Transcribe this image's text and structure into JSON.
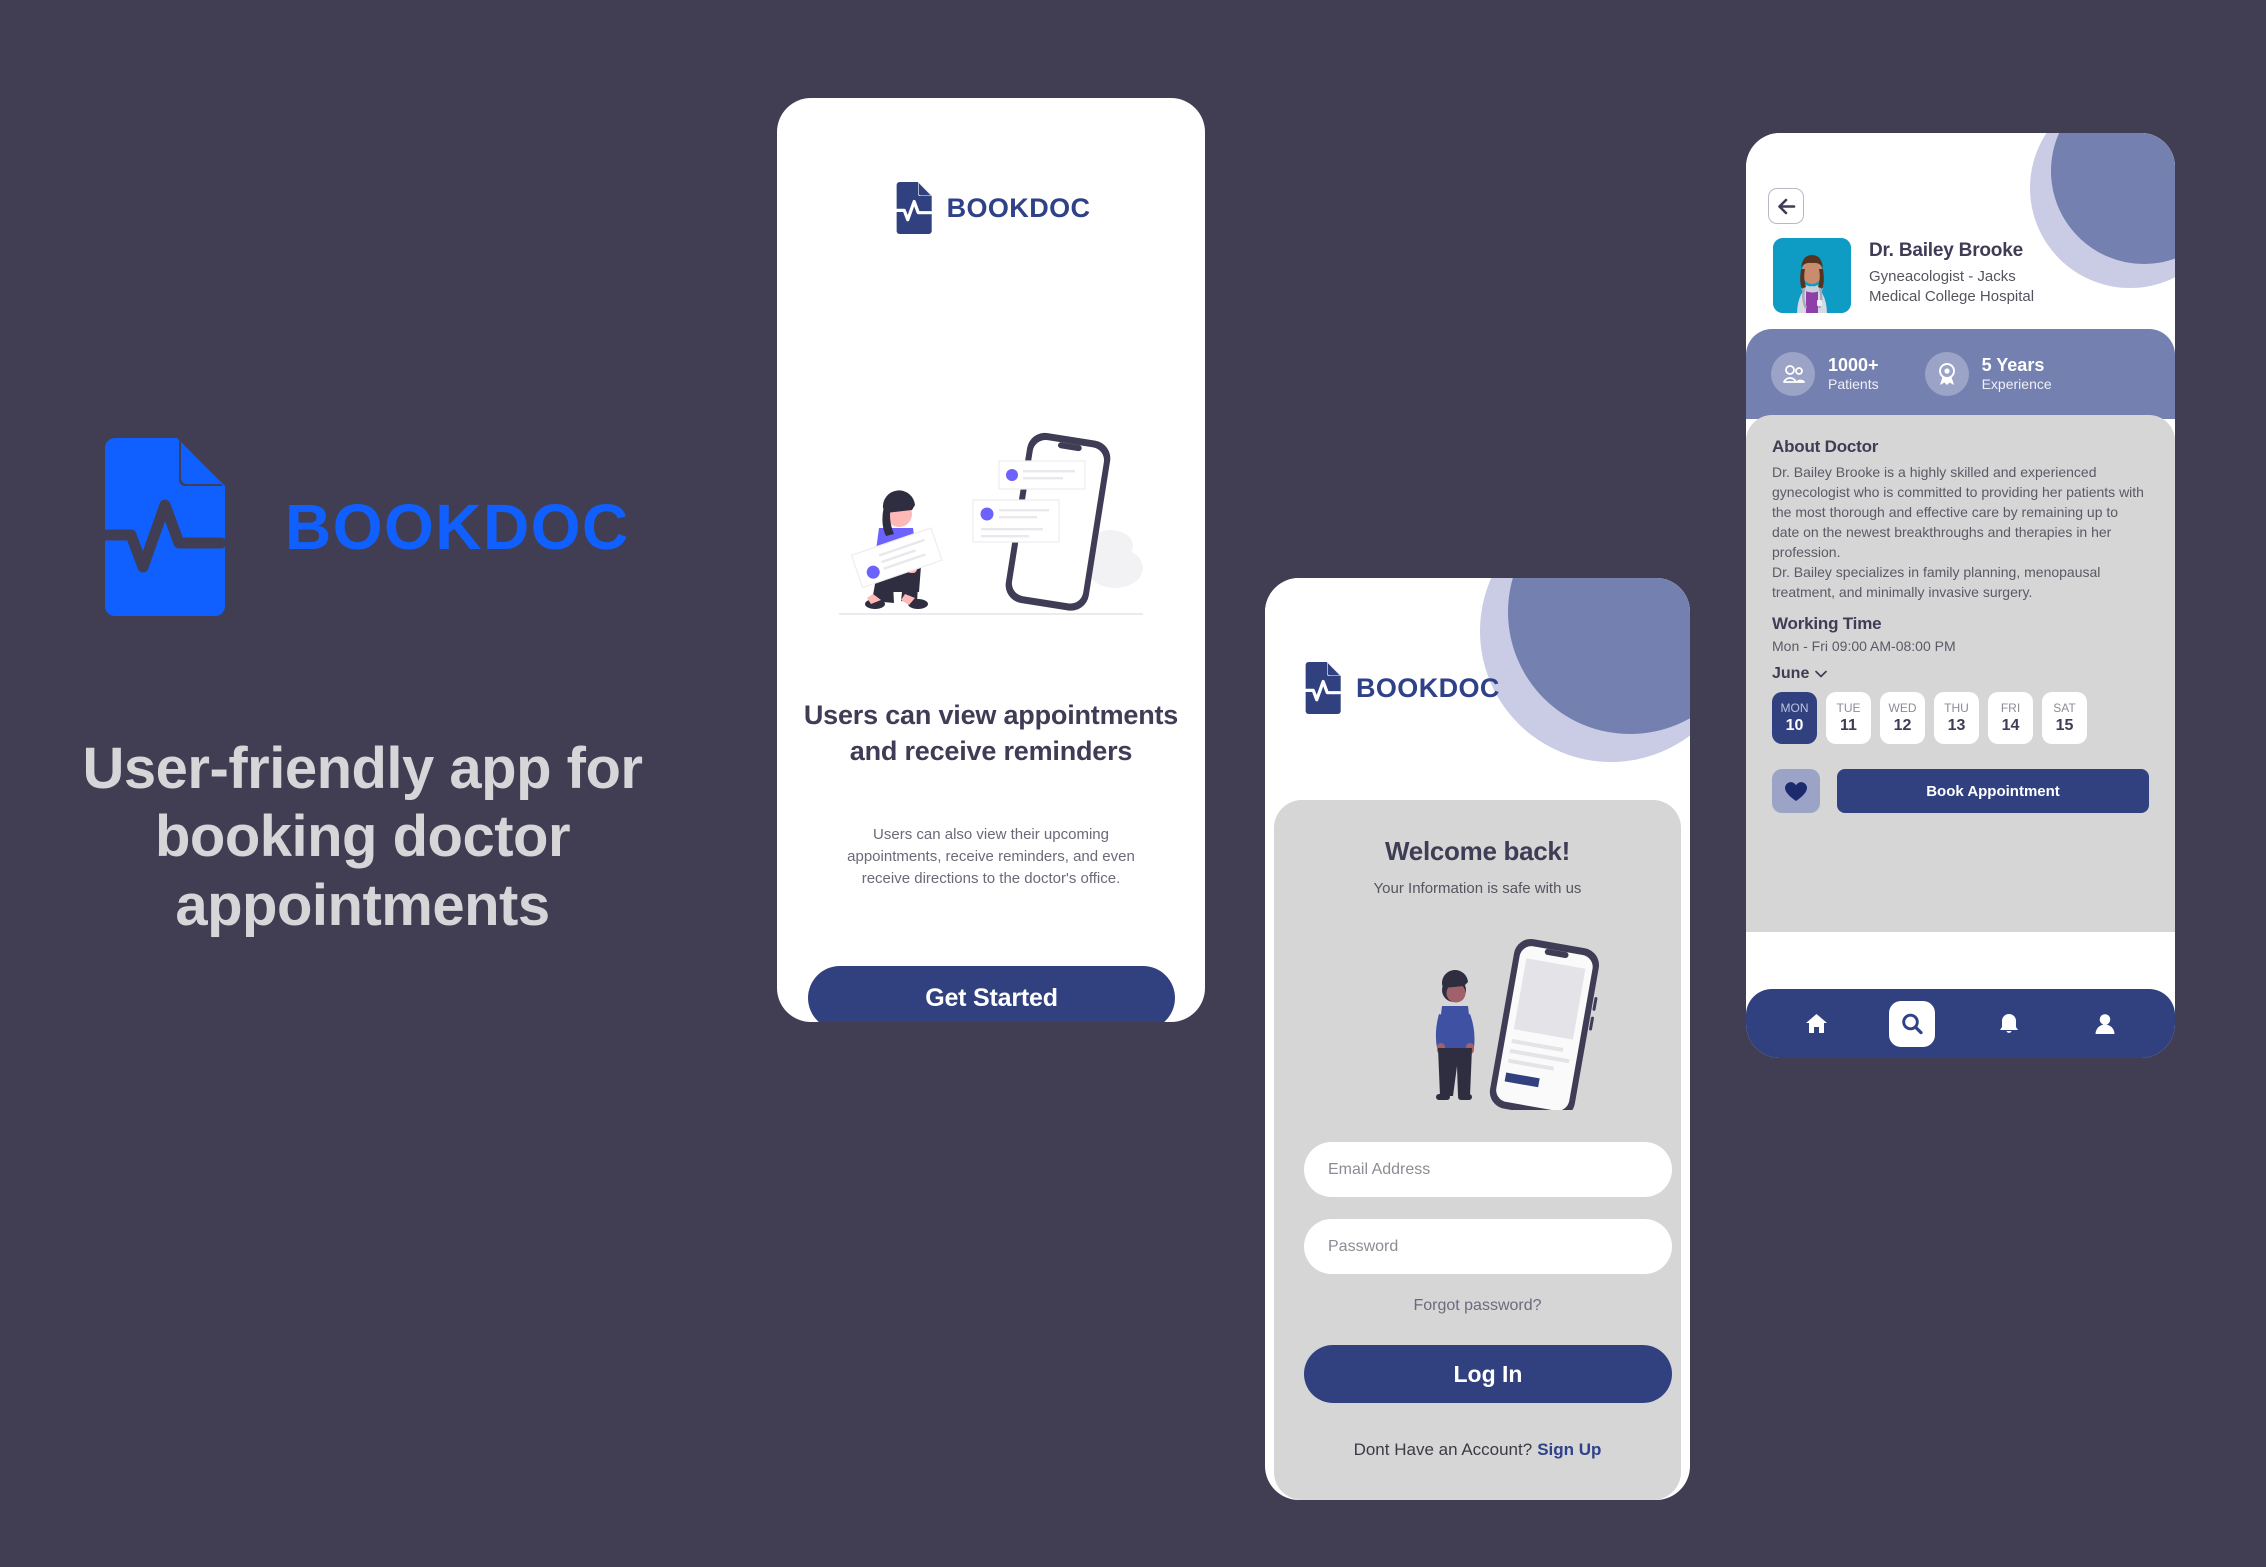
{
  "theme": {
    "page_background": "#413E53",
    "brand_blue": "#1060FF",
    "primary_navy": "#31417F",
    "accent_periwinkle": "#7480B0",
    "panel_gray": "#D6D6D6",
    "heading_color": "#3F3D56"
  },
  "hero": {
    "logo_icon": "document-pulse-icon",
    "logo_text": "BOOKDOC",
    "tagline": "User-friendly app for booking doctor appointments"
  },
  "onboarding": {
    "brand_icon": "document-pulse-icon",
    "brand_name": "BOOKDOC",
    "illustration": "woman-with-messages-phone-illustration",
    "title": "Users can view appointments and receive reminders",
    "subtitle": "Users can also view their upcoming appointments, receive reminders, and even receive directions to the doctor's office.",
    "cta_label": "Get Started"
  },
  "login": {
    "brand_icon": "document-pulse-icon",
    "brand_name": "BOOKDOC",
    "welcome_title": "Welcome back!",
    "welcome_subtitle": "Your Information is safe with us",
    "illustration": "man-looking-at-phone-illustration",
    "email_placeholder": "Email Address",
    "email_value": "",
    "password_placeholder": "Password",
    "password_value": "",
    "forgot_label": "Forgot password?",
    "submit_label": "Log In",
    "signup_prompt": "Dont Have an Account?",
    "signup_link": "Sign Up"
  },
  "doctor": {
    "back_icon": "arrow-left-icon",
    "avatar": "doctor-portrait-photo",
    "name": "Dr. Bailey Brooke",
    "specialty_line1": "Gyneacologist - Jacks",
    "specialty_line2": "Medical College Hospital",
    "stats": [
      {
        "icon": "patients-icon",
        "value": "1000+",
        "label": "Patients"
      },
      {
        "icon": "award-icon",
        "value": "5 Years",
        "label": "Experience"
      }
    ],
    "about_heading": "About Doctor",
    "about_paragraph1": "Dr. Bailey Brooke is a highly skilled and experienced gynecologist who is committed to providing her patients with the most thorough and effective care by remaining up to date on the newest breakthroughs and therapies in her profession.",
    "about_paragraph2": "Dr. Bailey specializes in family planning, menopausal treatment, and minimally invasive surgery.",
    "working_heading": "Working Time",
    "working_hours": "Mon - Fri 09:00 AM-08:00 PM",
    "month": "June",
    "month_caret_icon": "chevron-down-icon",
    "days": [
      {
        "dow": "MON",
        "num": "10",
        "selected": true
      },
      {
        "dow": "TUE",
        "num": "11",
        "selected": false
      },
      {
        "dow": "WED",
        "num": "12",
        "selected": false
      },
      {
        "dow": "THU",
        "num": "13",
        "selected": false
      },
      {
        "dow": "FRI",
        "num": "14",
        "selected": false
      },
      {
        "dow": "SAT",
        "num": "15",
        "selected": false
      }
    ],
    "favorite_icon": "heart-icon",
    "book_label": "Book Appointment",
    "nav": [
      {
        "icon": "home-icon",
        "active": false
      },
      {
        "icon": "search-icon",
        "active": true
      },
      {
        "icon": "bell-icon",
        "active": false
      },
      {
        "icon": "person-icon",
        "active": false
      }
    ]
  }
}
